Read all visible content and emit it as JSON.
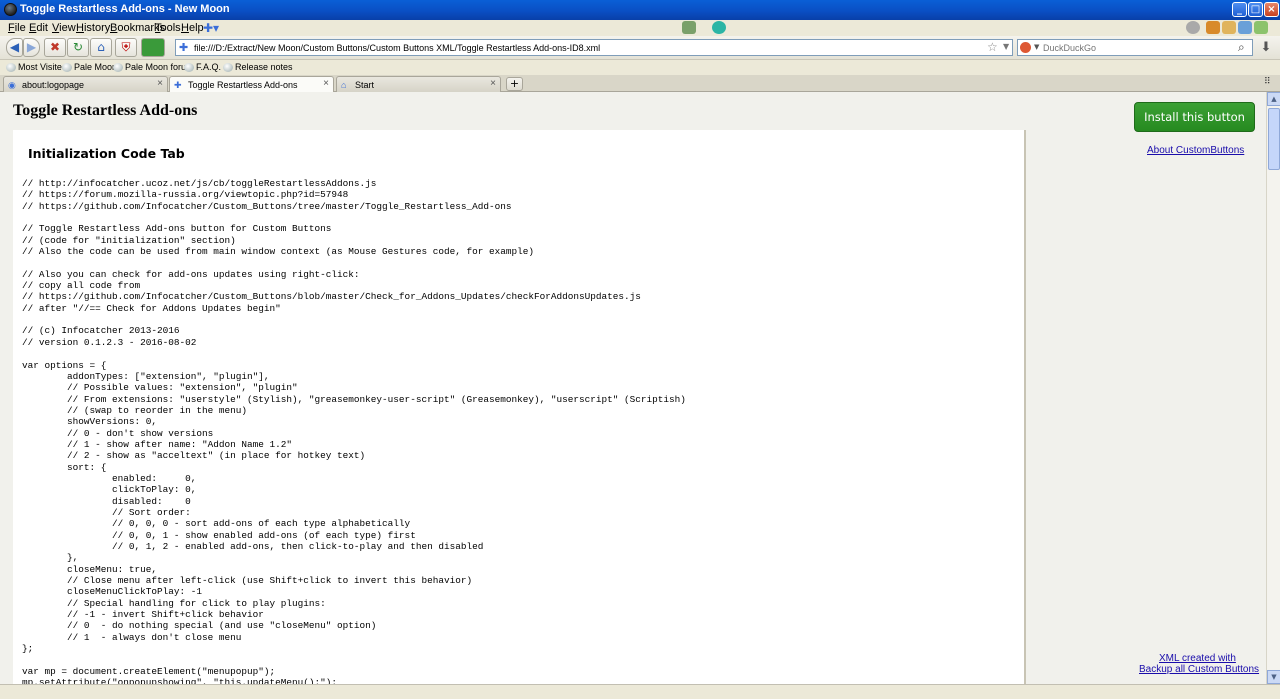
{
  "window": {
    "title": "Toggle Restartless Add-ons - New Moon"
  },
  "menubar": {
    "items": [
      "File",
      "Edit",
      "View",
      "History",
      "Bookmarks",
      "Tools",
      "Help"
    ]
  },
  "navbar": {
    "url": "file:///D:/Extract/New Moon/Custom Buttons/Custom Buttons XML/Toggle Restartless Add-ons-ID8.xml",
    "search_placeholder": "DuckDuckGo"
  },
  "bookmarks": [
    "Most Visited",
    "Pale Moon",
    "Pale Moon forum",
    "F.A.Q.",
    "Release notes"
  ],
  "tabs": [
    {
      "label": "about:logopage",
      "active": false
    },
    {
      "label": "Toggle Restartless Add-ons",
      "active": true
    },
    {
      "label": "Start",
      "active": false
    }
  ],
  "page": {
    "title": "Toggle Restartless Add-ons",
    "section_title": "Initialization Code Tab",
    "install_button": "Install this button",
    "about_link": "About CustomButtons",
    "footer_line1": "XML created with",
    "footer_line2": "Backup all Custom Buttons",
    "code": "// http://infocatcher.ucoz.net/js/cb/toggleRestartlessAddons.js\n// https://forum.mozilla-russia.org/viewtopic.php?id=57948\n// https://github.com/Infocatcher/Custom_Buttons/tree/master/Toggle_Restartless_Add-ons\n\n// Toggle Restartless Add-ons button for Custom Buttons\n// (code for \"initialization\" section)\n// Also the code can be used from main window context (as Mouse Gestures code, for example)\n\n// Also you can check for add-ons updates using right-click:\n// copy all code from\n// https://github.com/Infocatcher/Custom_Buttons/blob/master/Check_for_Addons_Updates/checkForAddonsUpdates.js\n// after \"//== Check for Addons Updates begin\"\n\n// (c) Infocatcher 2013-2016\n// version 0.1.2.3 - 2016-08-02\n\nvar options = {\n        addonTypes: [\"extension\", \"plugin\"],\n        // Possible values: \"extension\", \"plugin\"\n        // From extensions: \"userstyle\" (Stylish), \"greasemonkey-user-script\" (Greasemonkey), \"userscript\" (Scriptish)\n        // (swap to reorder in the menu)\n        showVersions: 0,\n        // 0 - don't show versions\n        // 1 - show after name: \"Addon Name 1.2\"\n        // 2 - show as \"acceltext\" (in place for hotkey text)\n        sort: {\n                enabled:     0,\n                clickToPlay: 0,\n                disabled:    0\n                // Sort order:\n                // 0, 0, 0 - sort add-ons of each type alphabetically\n                // 0, 0, 1 - show enabled add-ons (of each type) first\n                // 0, 1, 2 - enabled add-ons, then click-to-play and then disabled\n        },\n        closeMenu: true,\n        // Close menu after left-click (use Shift+click to invert this behavior)\n        closeMenuClickToPlay: -1\n        // Special handling for click to play plugins:\n        // -1 - invert Shift+click behavior\n        // 0  - do nothing special (and use \"closeMenu\" option)\n        // 1  - always don't close menu\n};\n\nvar mp = document.createElement(\"menupopup\");\nmp.setAttribute(\"onpopupshowing\", \"this.updateMenu();\");"
  }
}
